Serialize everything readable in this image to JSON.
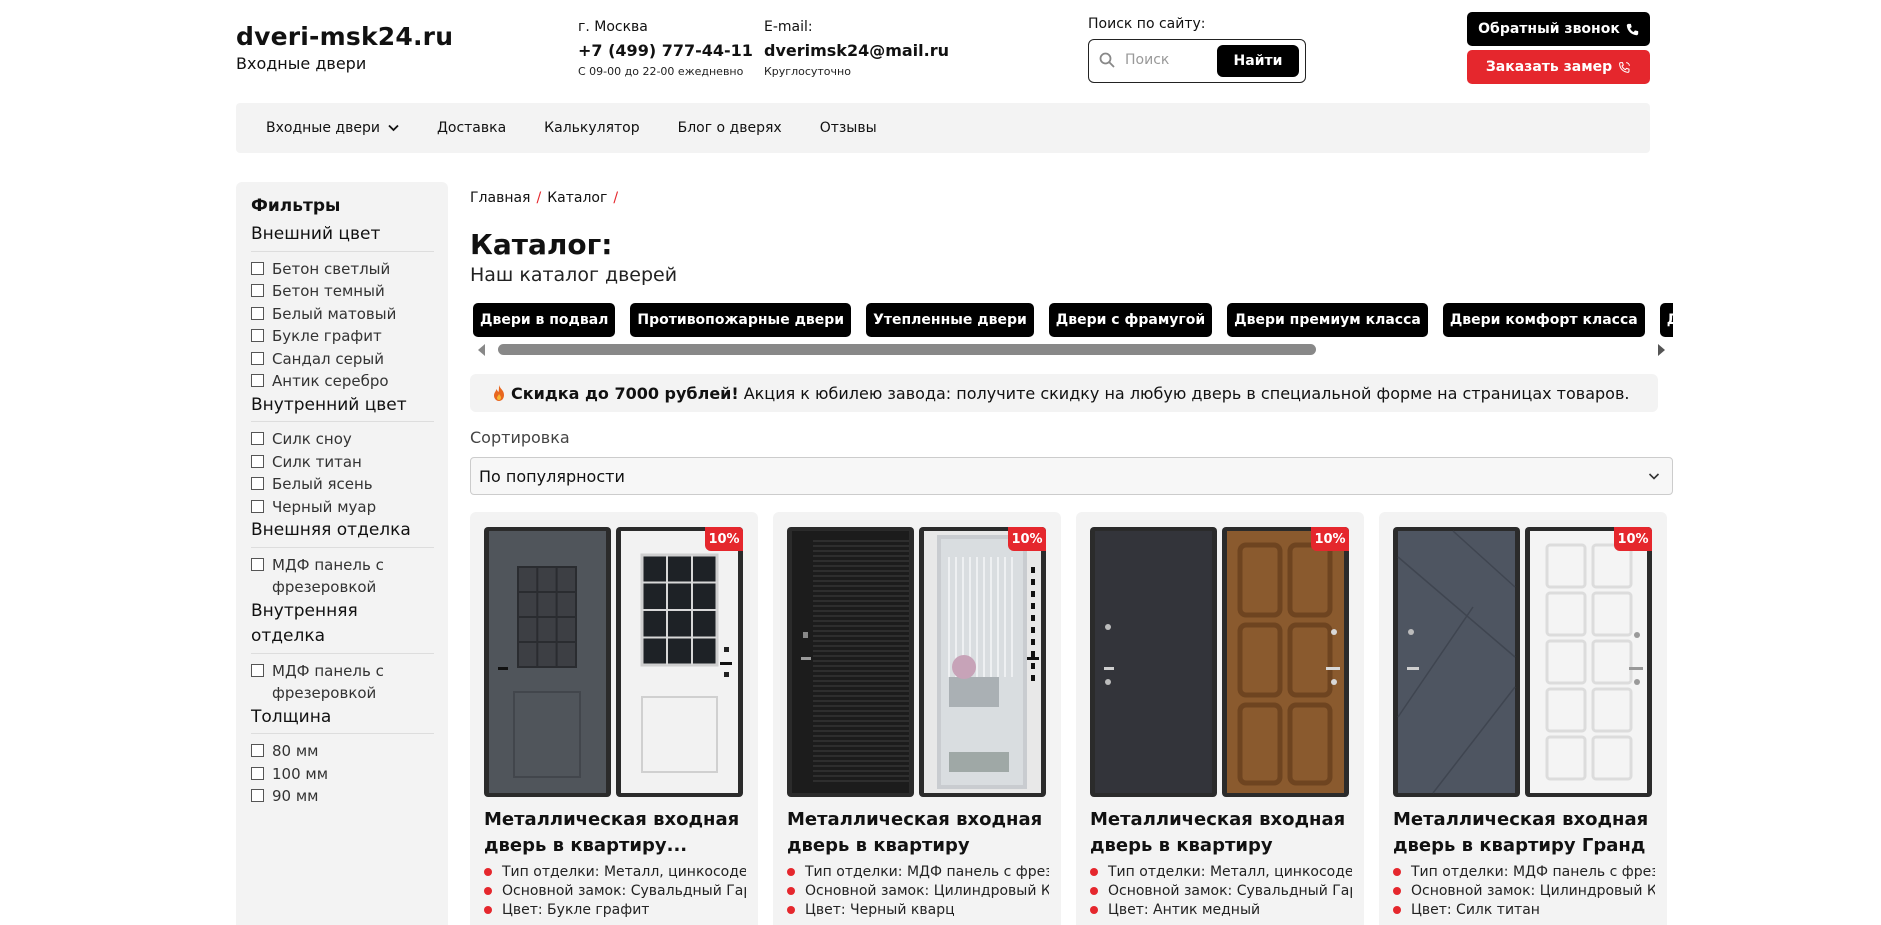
{
  "header": {
    "site_name": "dveri-msk24.ru",
    "tagline": "Входные двери",
    "phone": {
      "label": "г. Москва",
      "value": "+7 (499) 777-44-11",
      "note": "С 09-00 до 22-00 ежедневно"
    },
    "email": {
      "label": "E-mail:",
      "value": "dverimsk24@mail.ru",
      "note": "Круглосуточно"
    },
    "search": {
      "label": "Поиск по сайту:",
      "placeholder": "Поиск",
      "button": "Найти"
    },
    "callback_button": "Обратный звонок",
    "measure_button": "Заказать замер"
  },
  "nav": [
    {
      "label": "Входные двери",
      "has_dropdown": true
    },
    {
      "label": "Доставка"
    },
    {
      "label": "Калькулятор"
    },
    {
      "label": "Блог о дверях"
    },
    {
      "label": "Отзывы"
    }
  ],
  "filters": {
    "title": "Фильтры",
    "groups": [
      {
        "title": "Внешний цвет",
        "options": [
          "Бетон светлый",
          "Бетон темный",
          "Белый матовый",
          "Букле графит",
          "Сандал серый",
          "Антик серебро"
        ]
      },
      {
        "title": "Внутренний цвет",
        "options": [
          "Силк сноу",
          "Силк титан",
          "Белый ясень",
          "Черный муар"
        ]
      },
      {
        "title": "Внешняя отделка",
        "options": [
          "МДФ панель с фрезеровкой"
        ]
      },
      {
        "title": "Внутренняя отделка",
        "options": [
          "МДФ панель с фрезеровкой"
        ]
      },
      {
        "title": "Толщина",
        "options": [
          "80 мм",
          "100 мм",
          "90 мм"
        ]
      }
    ]
  },
  "breadcrumb": [
    "Главная",
    "Каталог"
  ],
  "page": {
    "title": "Каталог:",
    "subtitle": "Наш каталог дверей"
  },
  "categories": [
    "Двери в подвал",
    "Противопожарные двери",
    "Утепленные двери",
    "Двери с фрамугой",
    "Двери премиум класса",
    "Двери комфорт класса",
    "Двери со стеклом"
  ],
  "promo": {
    "icon": "fire-icon",
    "bold": "Скидка до 7000 рублей!",
    "text": "Акция к юбилею завода: получите скидку на любую дверь в специальной форме на страницах товаров."
  },
  "sort": {
    "label": "Сортировка",
    "selected": "По популярности"
  },
  "products": [
    {
      "badge": "10%",
      "title": "Металлическая входная дверь в квартиру...",
      "specs": [
        "Тип отделки: Металл, цинкосодержащий",
        "Основной замок: Сувальдный Гардиан",
        "Цвет: Букле графит"
      ],
      "outer_color": "#50555b",
      "inner_color": "#f2f2f2"
    },
    {
      "badge": "10%",
      "title": "Металлическая входная дверь в квартиру Labirint",
      "specs": [
        "Тип отделки: МДФ панель с фрезеровкой",
        "Основной замок: Цилиндровый Кале",
        "Цвет: Черный кварц"
      ],
      "outer_color": "#1c1c1c",
      "inner_color": "#e8e8e8"
    },
    {
      "badge": "10%",
      "title": "Металлическая входная дверь в квартиру Йошкар-Ола",
      "specs": [
        "Тип отделки: Металл, цинкосодержащий",
        "Основной замок: Сувальдный Гардиан",
        "Цвет: Антик медный"
      ],
      "outer_color": "#33343a",
      "inner_color": "#8a5a2e"
    },
    {
      "badge": "10%",
      "title": "Металлическая входная дверь в квартиру Гранд",
      "specs": [
        "Тип отделки: МДФ панель с фрезеровкой",
        "Основной замок: Цилиндровый Кале",
        "Цвет: Силк титан"
      ],
      "outer_color": "#4e5561",
      "inner_color": "#f4f4f4"
    }
  ],
  "colors": {
    "accent": "#e5272d",
    "dark": "#000000",
    "panel": "#f3f3f3"
  }
}
